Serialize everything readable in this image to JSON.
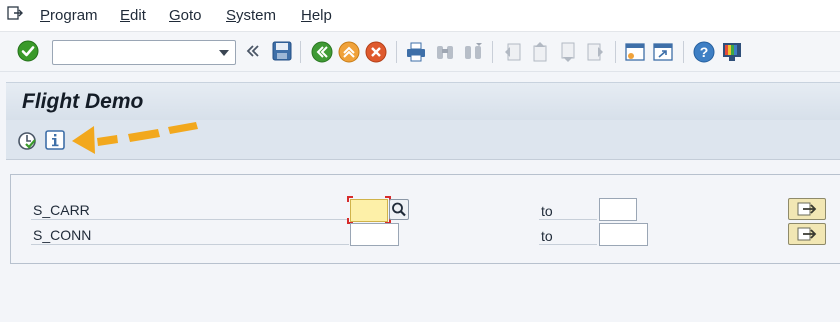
{
  "menubar": {
    "items": [
      {
        "label": "Program"
      },
      {
        "label": "Edit"
      },
      {
        "label": "Goto"
      },
      {
        "label": "System"
      },
      {
        "label": "Help"
      }
    ]
  },
  "toolbar": {
    "command_field": {
      "value": "",
      "placeholder": ""
    },
    "icons": [
      "enter-icon",
      "command-dropdown-icon",
      "collapse-icon",
      "save-icon",
      "back-icon",
      "exit-icon",
      "cancel-icon",
      "print-icon",
      "find-icon",
      "find-next-icon",
      "first-page-icon",
      "previous-page-icon",
      "next-page-icon",
      "last-page-icon",
      "create-session-icon",
      "shortcut-icon",
      "help-icon",
      "customize-layout-icon"
    ]
  },
  "title": {
    "text": "Flight Demo"
  },
  "app_toolbar": {
    "icons": [
      "execute-icon",
      "information-icon"
    ]
  },
  "selection": {
    "rows": [
      {
        "label": "S_CARR",
        "low": "",
        "to_label": "to",
        "high": ""
      },
      {
        "label": "S_CONN",
        "low": "",
        "to_label": "to",
        "high": ""
      }
    ]
  },
  "annotation": {
    "color": "#f2a81d"
  },
  "colors": {
    "accent_green": "#3a9a2a",
    "title_bg": "#dde5ee",
    "focused_field": "#fdf0a8",
    "focus_marker": "#d62c2c"
  }
}
